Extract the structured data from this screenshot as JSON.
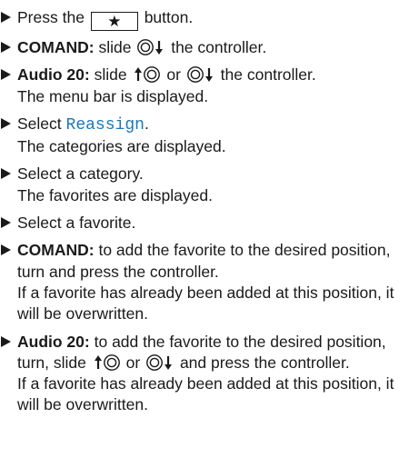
{
  "steps": [
    {
      "text_before": "Press the",
      "key": "★",
      "text_after": "button."
    },
    {
      "label": "COMAND:",
      "text_before": "slide",
      "text_after": "the controller."
    },
    {
      "label": "Audio 20:",
      "text_before": "slide",
      "or": "or",
      "text_after": "the controller.",
      "result": "The menu bar is displayed."
    },
    {
      "text_before": "Select",
      "menu_item": "Reassign",
      "text_after": ".",
      "result": "The categories are displayed."
    },
    {
      "text": "Select a category.",
      "result": "The favorites are displayed."
    },
    {
      "text": "Select a favorite."
    },
    {
      "label": "COMAND:",
      "text": "to add the favorite to the desired position, turn and press the controller.",
      "result": "If a favorite has already been added at this position, it will be overwritten."
    },
    {
      "label": "Audio 20:",
      "text_before": "to add the favorite to the desired position, turn, slide",
      "or": "or",
      "text_after": "and press the controller.",
      "result": "If a favorite has already been added at this position, it will be overwritten."
    }
  ],
  "icons": {
    "controller_slide_up": "controller-slide-up-icon",
    "controller_slide_down": "controller-slide-down-icon",
    "star_key": "star-key-icon"
  }
}
